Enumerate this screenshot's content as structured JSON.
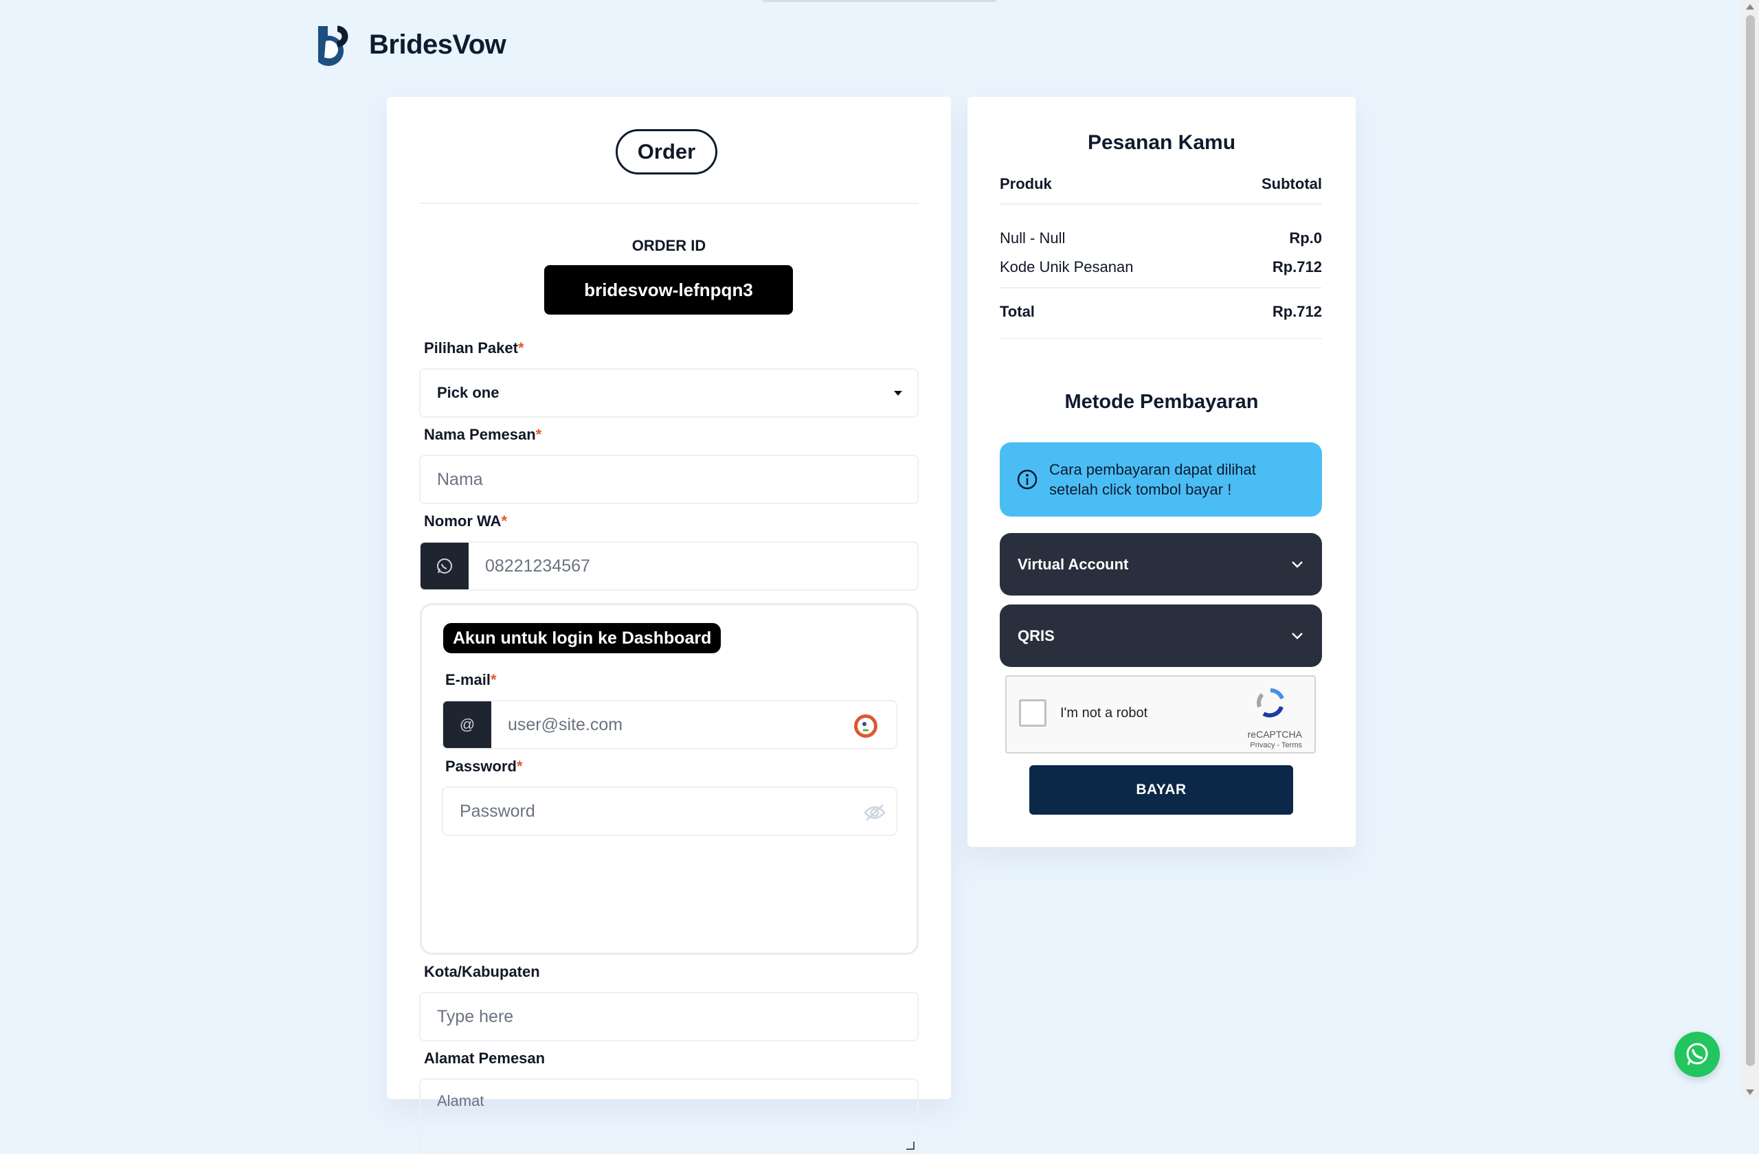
{
  "brand": {
    "name": "BridesVow"
  },
  "order_form": {
    "title": "Order",
    "order_id_label": "ORDER ID",
    "order_id_value": "bridesvow-lefnpqn3",
    "package": {
      "label": "Pilihan Paket",
      "selected": "Pick one"
    },
    "name": {
      "label": "Nama Pemesan",
      "placeholder": "Nama"
    },
    "whatsapp": {
      "label": "Nomor WA",
      "placeholder": "08221234567"
    },
    "account": {
      "title": "Akun untuk login ke Dashboard",
      "email": {
        "label": "E-mail",
        "placeholder": "user@site.com",
        "addon": "@"
      },
      "password": {
        "label": "Password",
        "placeholder": "Password"
      }
    },
    "city": {
      "label": "Kota/Kabupaten",
      "placeholder": "Type here"
    },
    "address": {
      "label": "Alamat Pemesan",
      "placeholder": "Alamat"
    },
    "required_mark": "*"
  },
  "summary": {
    "title": "Pesanan Kamu",
    "col_product": "Produk",
    "col_subtotal": "Subtotal",
    "items": [
      {
        "name": "Null - Null",
        "price": "Rp.0"
      },
      {
        "name": "Kode Unik Pesanan",
        "price": "Rp.712"
      }
    ],
    "total_label": "Total",
    "total_value": "Rp.712"
  },
  "payment": {
    "title": "Metode Pembayaran",
    "info_line1": "Cara pembayaran dapat dilihat",
    "info_line2": "setelah click tombol bayar !",
    "methods": [
      "Virtual Account",
      "QRIS"
    ],
    "captcha_label": "I'm not a robot",
    "captcha_brand": "reCAPTCHA",
    "captcha_terms": "Privacy - Terms",
    "pay_button": "BAYAR"
  },
  "colors": {
    "background": "#eaf4fd",
    "info": "#4bbdf5",
    "method": "#2a2f3d",
    "pay_button": "#0b2848",
    "required": "#e05a2a",
    "whatsapp": "#22c55e"
  }
}
